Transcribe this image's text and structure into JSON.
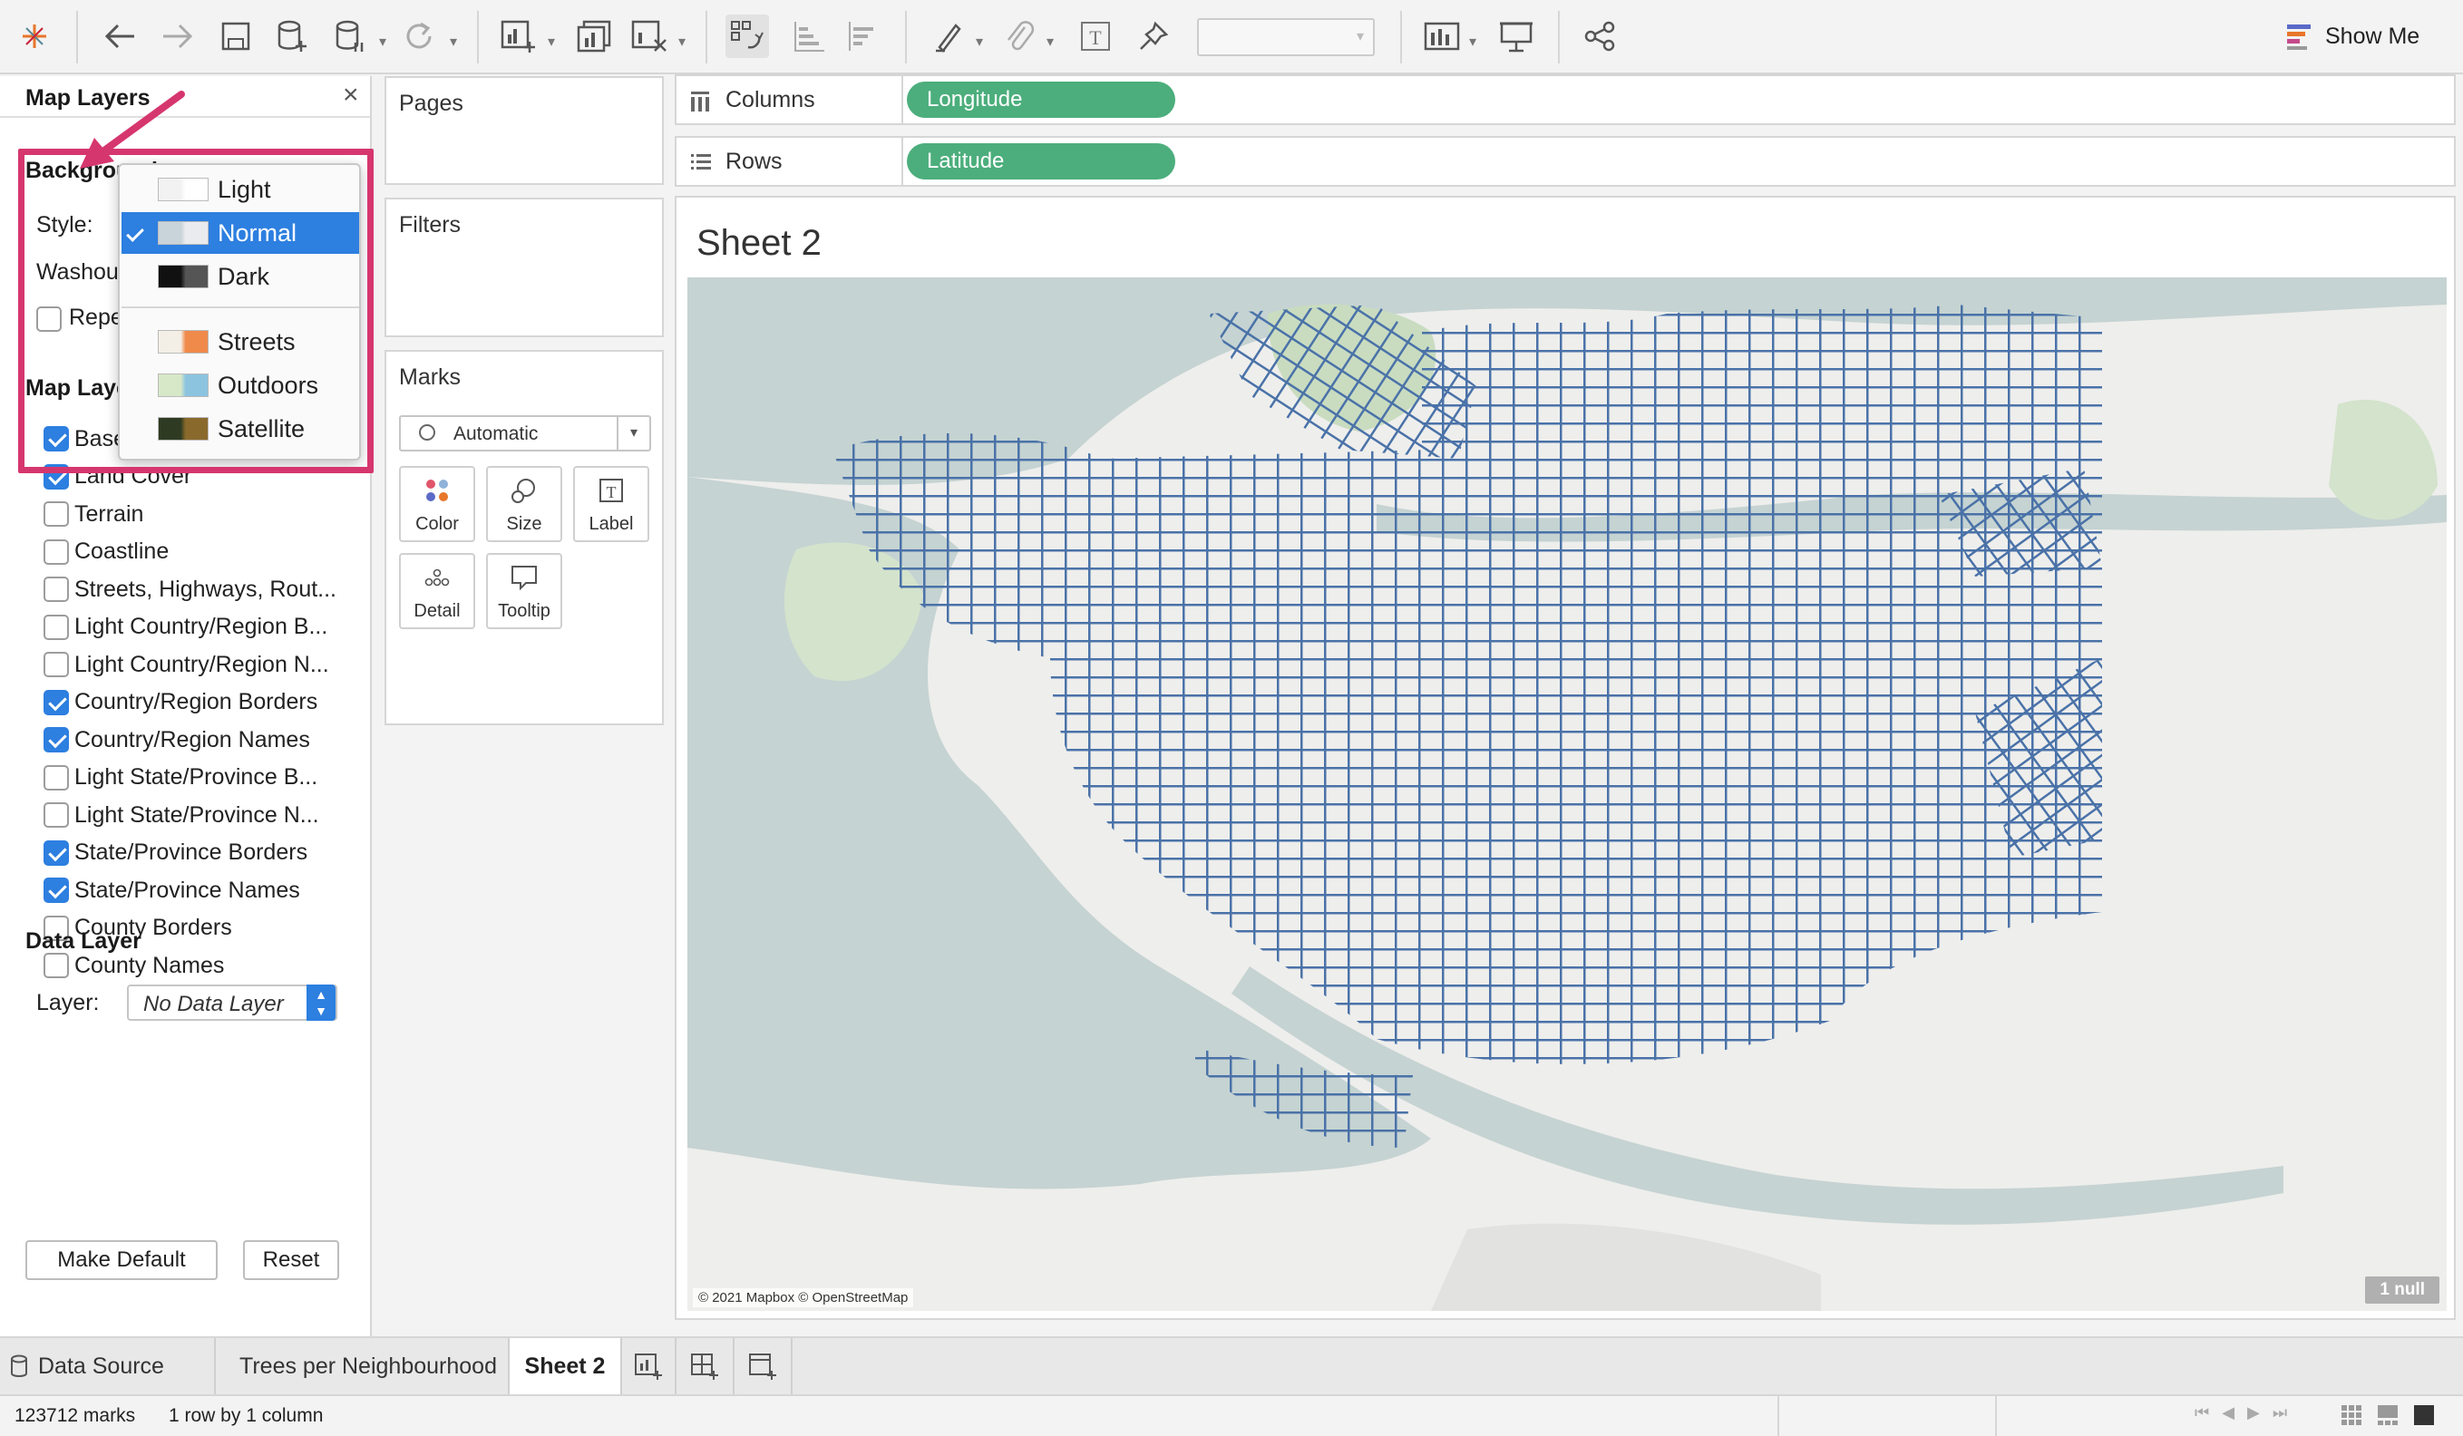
{
  "toolbar": {
    "show_me_label": "Show Me",
    "icons": [
      "tableau-logo-icon",
      "undo-icon",
      "redo-icon",
      "save-icon",
      "new-datasource-icon",
      "pause-updates-icon",
      "refresh-icon",
      "new-worksheet-icon",
      "duplicate-sheet-icon",
      "clear-sheet-icon",
      "swap-icon",
      "sort-ascending-icon",
      "sort-descending-icon",
      "highlight-icon",
      "group-icon",
      "show-labels-icon",
      "fix-axes-icon",
      "fit-dropdown",
      "show-cards-icon",
      "presentation-icon",
      "share-icon"
    ]
  },
  "left_panel": {
    "title": "Map Layers",
    "close_symbol": "×",
    "background_heading": "Background",
    "style_label": "Style:",
    "washout_label": "Washout",
    "repeat_label": "Repeat",
    "map_layers_heading": "Map Layers",
    "layers": [
      {
        "label": "Base",
        "checked": true
      },
      {
        "label": "Land Cover",
        "checked": true
      },
      {
        "label": "Terrain",
        "checked": false
      },
      {
        "label": "Coastline",
        "checked": false
      },
      {
        "label": "Streets, Highways, Rout...",
        "checked": false
      },
      {
        "label": "Light Country/Region B...",
        "checked": false
      },
      {
        "label": "Light Country/Region N...",
        "checked": false
      },
      {
        "label": "Country/Region Borders",
        "checked": true
      },
      {
        "label": "Country/Region Names",
        "checked": true
      },
      {
        "label": "Light State/Province B...",
        "checked": false
      },
      {
        "label": "Light State/Province N...",
        "checked": false
      },
      {
        "label": "State/Province Borders",
        "checked": true
      },
      {
        "label": "State/Province Names",
        "checked": true
      },
      {
        "label": "County Borders",
        "checked": false
      },
      {
        "label": "County Names",
        "checked": false
      }
    ],
    "data_layer_heading": "Data Layer",
    "layer_label": "Layer:",
    "layer_value": "No Data Layer",
    "make_default_label": "Make Default",
    "reset_label": "Reset"
  },
  "style_menu": {
    "items": [
      {
        "label": "Light",
        "selected": false,
        "swatch": [
          "#f2f2f2",
          "#ffffff"
        ]
      },
      {
        "label": "Normal",
        "selected": true,
        "swatch": [
          "#c9d3da",
          "#e9ebee"
        ]
      },
      {
        "label": "Dark",
        "selected": false,
        "swatch": [
          "#111111",
          "#555555"
        ]
      },
      {
        "label": "Streets",
        "selected": false,
        "swatch": [
          "#f4efe6",
          "#ef8a4b"
        ]
      },
      {
        "label": "Outdoors",
        "selected": false,
        "swatch": [
          "#d7e8c8",
          "#8cc4e0"
        ]
      },
      {
        "label": "Satellite",
        "selected": false,
        "swatch": [
          "#2e3b22",
          "#8a6a2c"
        ]
      }
    ]
  },
  "cards": {
    "pages_title": "Pages",
    "filters_title": "Filters",
    "marks_title": "Marks",
    "mark_type": "Automatic",
    "mark_buttons": [
      "Color",
      "Size",
      "Label",
      "Detail",
      "Tooltip"
    ]
  },
  "shelves": {
    "columns_label": "Columns",
    "columns_pill": "Longitude",
    "rows_label": "Rows",
    "rows_pill": "Latitude"
  },
  "viz": {
    "sheet_title": "Sheet 2",
    "attribution": "© 2021 Mapbox © OpenStreetMap",
    "null_badge": "1 null",
    "mark_color": "#4a72a8"
  },
  "tabs": {
    "data_source": "Data Source",
    "sheets": [
      "Trees per Neighbourhood",
      "Sheet 2"
    ],
    "active": "Sheet 2"
  },
  "status": {
    "marks": "123712 marks",
    "dimensions": "1 row by 1 column"
  },
  "colors": {
    "accent": "#2d7fe0",
    "pill": "#4cae7c",
    "annotation": "#d6366e"
  }
}
